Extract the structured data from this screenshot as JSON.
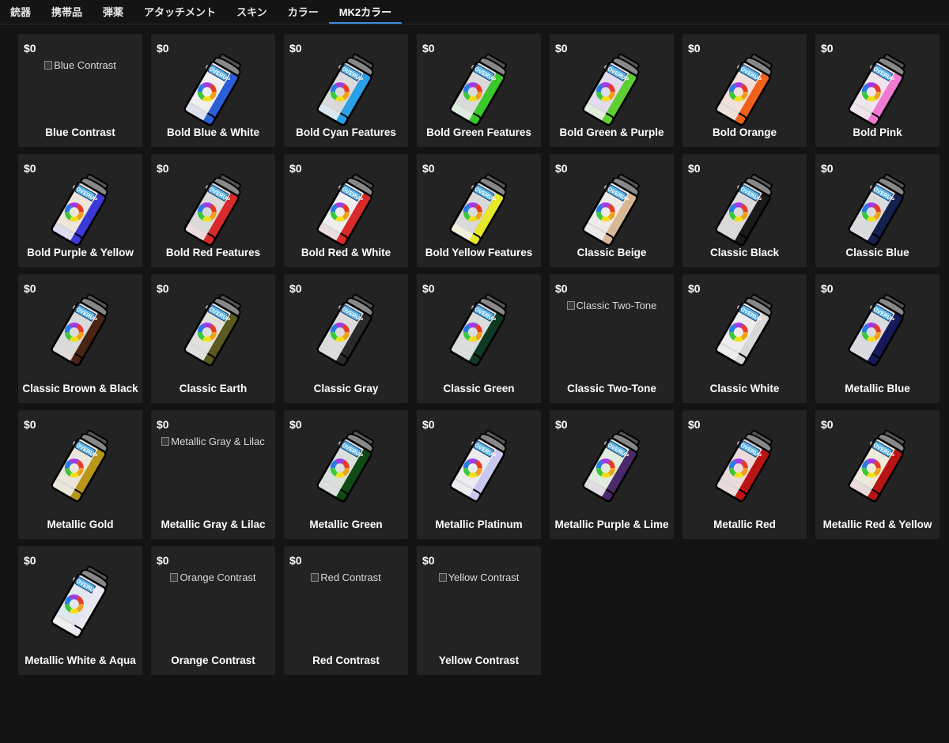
{
  "tabs": [
    {
      "label": "銃器",
      "active": false
    },
    {
      "label": "携帯品",
      "active": false
    },
    {
      "label": "弾薬",
      "active": false
    },
    {
      "label": "アタッチメント",
      "active": false
    },
    {
      "label": "スキン",
      "active": false
    },
    {
      "label": "カラー",
      "active": false
    },
    {
      "label": "MK2カラー",
      "active": true
    }
  ],
  "items": [
    {
      "price": "$0",
      "name": "Blue Contrast",
      "broken": true,
      "alt": "Blue Contrast"
    },
    {
      "price": "$0",
      "name": "Bold Blue & White",
      "colors": [
        "#2a5fd8",
        "#e8e8e8"
      ]
    },
    {
      "price": "$0",
      "name": "Bold Cyan Features",
      "colors": [
        "#2aa0e8",
        "#1a1a1a"
      ]
    },
    {
      "price": "$0",
      "name": "Bold Green Features",
      "colors": [
        "#39c92b",
        "#1a1a1a"
      ]
    },
    {
      "price": "$0",
      "name": "Bold Green & Purple",
      "colors": [
        "#5fd033",
        "#5a2fd0"
      ]
    },
    {
      "price": "$0",
      "name": "Bold Orange",
      "colors": [
        "#f0621c",
        "#f0621c"
      ]
    },
    {
      "price": "$0",
      "name": "Bold Pink",
      "colors": [
        "#f07ad2",
        "#f07ad2"
      ]
    },
    {
      "price": "$0",
      "name": "Bold Purple & Yellow",
      "colors": [
        "#3a3ad8",
        "#e88a1a"
      ]
    },
    {
      "price": "$0",
      "name": "Bold Red Features",
      "colors": [
        "#d82a2a",
        "#1a1a1a"
      ]
    },
    {
      "price": "$0",
      "name": "Bold Red & White",
      "colors": [
        "#d82a2a",
        "#e8e8e8"
      ]
    },
    {
      "price": "$0",
      "name": "Bold Yellow Features",
      "colors": [
        "#e8e82a",
        "#1a1a1a"
      ]
    },
    {
      "price": "$0",
      "name": "Classic Beige",
      "colors": [
        "#d8b894",
        "#d8b894"
      ]
    },
    {
      "price": "$0",
      "name": "Classic Black",
      "colors": [
        "#1a1a1a",
        "#1a1a1a"
      ]
    },
    {
      "price": "$0",
      "name": "Classic Blue",
      "colors": [
        "#14204e",
        "#14204e"
      ]
    },
    {
      "price": "$0",
      "name": "Classic Brown & Black",
      "colors": [
        "#4a2414",
        "#1a1a1a"
      ]
    },
    {
      "price": "$0",
      "name": "Classic Earth",
      "colors": [
        "#5a5a20",
        "#5a5a20"
      ]
    },
    {
      "price": "$0",
      "name": "Classic Gray",
      "colors": [
        "#2a2a2a",
        "#2a2a2a"
      ]
    },
    {
      "price": "$0",
      "name": "Classic Green",
      "colors": [
        "#0e3a24",
        "#0e3a24"
      ]
    },
    {
      "price": "$0",
      "name": "Classic Two-Tone",
      "broken": true,
      "alt": "Classic Two-Tone"
    },
    {
      "price": "$0",
      "name": "Classic White",
      "colors": [
        "#d8d8d8",
        "#d8d8d8"
      ]
    },
    {
      "price": "$0",
      "name": "Metallic Blue",
      "colors": [
        "#141a5a",
        "#141a5a"
      ]
    },
    {
      "price": "$0",
      "name": "Metallic Gold",
      "colors": [
        "#b8961a",
        "#b8961a"
      ]
    },
    {
      "price": "$0",
      "name": "Metallic Gray & Lilac",
      "broken": true,
      "alt": "Metallic Gray & Lilac"
    },
    {
      "price": "$0",
      "name": "Metallic Green",
      "colors": [
        "#0e4a14",
        "#0e4a14"
      ]
    },
    {
      "price": "$0",
      "name": "Metallic Platinum",
      "colors": [
        "#c8c8f0",
        "#c8c8f0"
      ]
    },
    {
      "price": "$0",
      "name": "Metallic Purple & Lime",
      "colors": [
        "#4a2a6a",
        "#5ad02a"
      ]
    },
    {
      "price": "$0",
      "name": "Metallic Red",
      "colors": [
        "#b81414",
        "#b81414"
      ]
    },
    {
      "price": "$0",
      "name": "Metallic Red & Yellow",
      "colors": [
        "#b81414",
        "#e8a81a"
      ]
    },
    {
      "price": "$0",
      "name": "Metallic White & Aqua",
      "colors": [
        "#e8e8f0",
        "#5a9ae8"
      ]
    },
    {
      "price": "$0",
      "name": "Orange Contrast",
      "broken": true,
      "alt": "Orange Contrast"
    },
    {
      "price": "$0",
      "name": "Red Contrast",
      "broken": true,
      "alt": "Red Contrast"
    },
    {
      "price": "$0",
      "name": "Yellow Contrast",
      "broken": true,
      "alt": "Yellow Contrast"
    }
  ],
  "icons": {
    "spray_can": "spray-can-icon",
    "broken_image": "broken-image-icon"
  }
}
